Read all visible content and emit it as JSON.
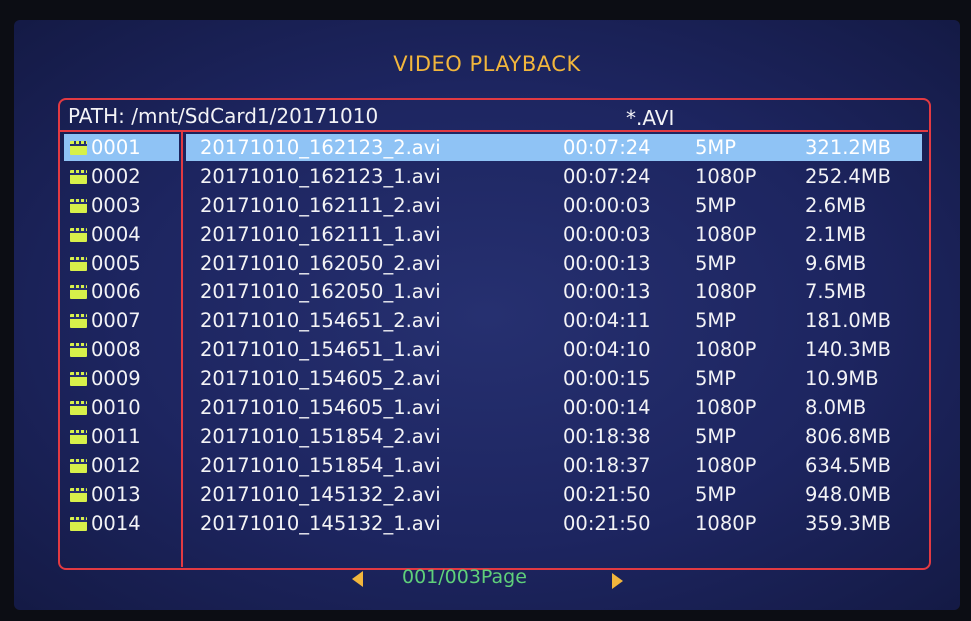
{
  "app": {
    "title": "VIDEO PLAYBACK"
  },
  "header": {
    "path_label": "PATH: /mnt/SdCard1/20171010",
    "filter": "*.AVI"
  },
  "files": [
    {
      "num": "0001",
      "name": "20171010_162123_2.avi",
      "duration": "00:07:24",
      "resolution": "5MP",
      "size": "321.2MB",
      "selected": true
    },
    {
      "num": "0002",
      "name": "20171010_162123_1.avi",
      "duration": "00:07:24",
      "resolution": "1080P",
      "size": "252.4MB"
    },
    {
      "num": "0003",
      "name": "20171010_162111_2.avi",
      "duration": "00:00:03",
      "resolution": "5MP",
      "size": "2.6MB"
    },
    {
      "num": "0004",
      "name": "20171010_162111_1.avi",
      "duration": "00:00:03",
      "resolution": "1080P",
      "size": "2.1MB"
    },
    {
      "num": "0005",
      "name": "20171010_162050_2.avi",
      "duration": "00:00:13",
      "resolution": "5MP",
      "size": "9.6MB"
    },
    {
      "num": "0006",
      "name": "20171010_162050_1.avi",
      "duration": "00:00:13",
      "resolution": "1080P",
      "size": "7.5MB"
    },
    {
      "num": "0007",
      "name": "20171010_154651_2.avi",
      "duration": "00:04:11",
      "resolution": "5MP",
      "size": "181.0MB"
    },
    {
      "num": "0008",
      "name": "20171010_154651_1.avi",
      "duration": "00:04:10",
      "resolution": "1080P",
      "size": "140.3MB"
    },
    {
      "num": "0009",
      "name": "20171010_154605_2.avi",
      "duration": "00:00:15",
      "resolution": "5MP",
      "size": "10.9MB"
    },
    {
      "num": "0010",
      "name": "20171010_154605_1.avi",
      "duration": "00:00:14",
      "resolution": "1080P",
      "size": "8.0MB"
    },
    {
      "num": "0011",
      "name": "20171010_151854_2.avi",
      "duration": "00:18:38",
      "resolution": "5MP",
      "size": "806.8MB"
    },
    {
      "num": "0012",
      "name": "20171010_151854_1.avi",
      "duration": "00:18:37",
      "resolution": "1080P",
      "size": "634.5MB"
    },
    {
      "num": "0013",
      "name": "20171010_145132_2.avi",
      "duration": "00:21:50",
      "resolution": "5MP",
      "size": "948.0MB"
    },
    {
      "num": "0014",
      "name": "20171010_145132_1.avi",
      "duration": "00:21:50",
      "resolution": "1080P",
      "size": "359.3MB"
    }
  ],
  "pager": {
    "label": "001/003Page",
    "prev_icon": "left-triangle",
    "next_icon": "right-triangle"
  },
  "colors": {
    "background": "#1d2560",
    "title": "#f2b63c",
    "border": "#e23a42",
    "text": "#f3f3f6",
    "selection": "#8fc3f5",
    "file_icon": "#d7f04a",
    "page_label": "#5fd07a"
  },
  "icons": {
    "file_icon": "video-file-icon"
  }
}
